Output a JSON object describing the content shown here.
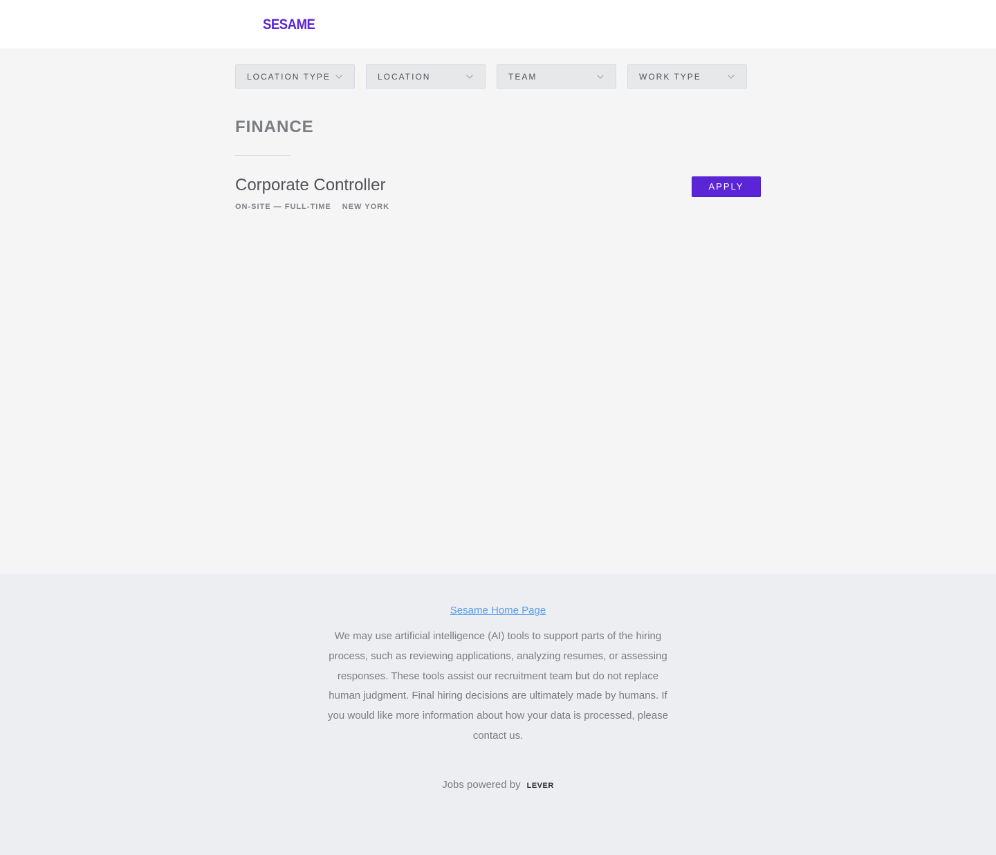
{
  "header": {
    "logo_text": "SESAME"
  },
  "filters": [
    {
      "label": "LOCATION TYPE"
    },
    {
      "label": "LOCATION"
    },
    {
      "label": "TEAM"
    },
    {
      "label": "WORK TYPE"
    }
  ],
  "section": {
    "title": "FINANCE"
  },
  "postings": [
    {
      "title": "Corporate Controller",
      "work_type": "ON-SITE — FULL-TIME",
      "location": "NEW YORK",
      "apply_label": "APPLY"
    }
  ],
  "footer": {
    "home_link": "Sesame Home Page",
    "ai_notice": "We may use artificial intelligence (AI) tools to support parts of the hiring process, such as reviewing applications, analyzing resumes, or assessing responses. These tools assist our recruitment team but do not replace human judgment. Final hiring decisions are ultimately made by humans. If you would like more information about how your data is processed, please contact us.",
    "powered_by": "Jobs powered by",
    "lever_logo": "LEVER"
  },
  "colors": {
    "brand": "#5b24d6",
    "link": "#579eee",
    "page_bg": "#f5f5f6",
    "footer_bg": "#edeef1"
  },
  "icons": {
    "filter_chevron": "chevron-down-icon"
  }
}
